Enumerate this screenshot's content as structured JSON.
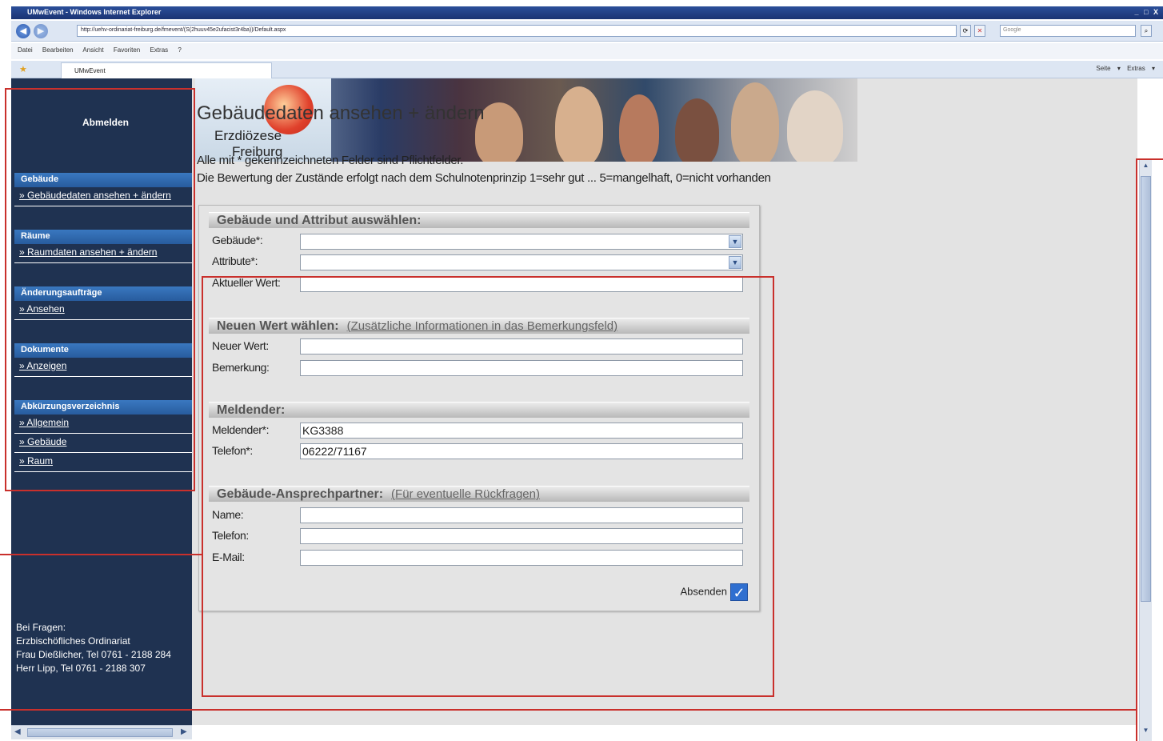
{
  "browser": {
    "title": "UMwEvent - Windows Internet Explorer",
    "window_controls": "_ □ X",
    "url": "http://uehv-ordinariat-freiburg.de/fmevent/(S(2huuv45e2ufacist3r4ba))/Default.aspx",
    "search_placeholder": "Google",
    "menu": [
      "Datei",
      "Bearbeiten",
      "Ansicht",
      "Favoriten",
      "Extras",
      "?"
    ],
    "tab_title": "UMwEvent",
    "tab_tools": "Seite ▾ Extras ▾"
  },
  "sidebar": {
    "logout": "Abmelden",
    "groups": [
      {
        "heading": "Gebäude",
        "links": [
          "» Gebäudedaten ansehen + ändern"
        ]
      },
      {
        "heading": "Räume",
        "links": [
          "» Raumdaten ansehen + ändern"
        ]
      },
      {
        "heading": "Änderungsaufträge",
        "links": [
          "» Ansehen"
        ]
      },
      {
        "heading": "Dokumente",
        "links": [
          "» Anzeigen"
        ]
      },
      {
        "heading": "Abkürzungsverzeichnis",
        "links": [
          "» Allgemein",
          "» Gebäude",
          "» Raum"
        ]
      }
    ],
    "contact": [
      "Bei Fragen:",
      "Erzbischöfliches Ordinariat",
      "Frau Dießlicher, Tel 0761 - 2188 284",
      "Herr Lipp, Tel 0761 - 2188 307"
    ]
  },
  "banner": {
    "line1": "Erzdiözese",
    "line2": "Freiburg"
  },
  "main": {
    "title": "Gebäudedaten ansehen + ändern",
    "intro1": "Alle mit * gekennzeichneten Felder sind Pflichtfelder.",
    "intro2": "Die Bewertung der Zustände erfolgt nach dem Schulnotenprinzip 1=sehr gut ... 5=mangelhaft, 0=nicht vorhanden"
  },
  "form": {
    "sec1": {
      "title": "Gebäude und Attribut auswählen:",
      "gebaeude_label": "Gebäude*:",
      "attribute_label": "Attribute*:",
      "aktuell_label": "Aktueller Wert:",
      "aktuell_value": ""
    },
    "sec2": {
      "title": "Neuen Wert wählen:",
      "subtitle": "(Zusätzliche Informationen in das Bemerkungsfeld)",
      "neuer_label": "Neuer Wert:",
      "neuer_value": "",
      "bemerkung_label": "Bemerkung:",
      "bemerkung_value": ""
    },
    "sec3": {
      "title": "Meldender:",
      "meldender_label": "Meldender*:",
      "meldender_value": "KG3388",
      "telefon_label": "Telefon*:",
      "telefon_value": "06222/71167"
    },
    "sec4": {
      "title": "Gebäude-Ansprechpartner:",
      "subtitle": "(Für eventuelle Rückfragen)",
      "name_label": "Name:",
      "name_value": "",
      "telefon_label": "Telefon:",
      "telefon_value": "",
      "email_label": "E-Mail:",
      "email_value": ""
    },
    "submit_label": "Absenden"
  }
}
